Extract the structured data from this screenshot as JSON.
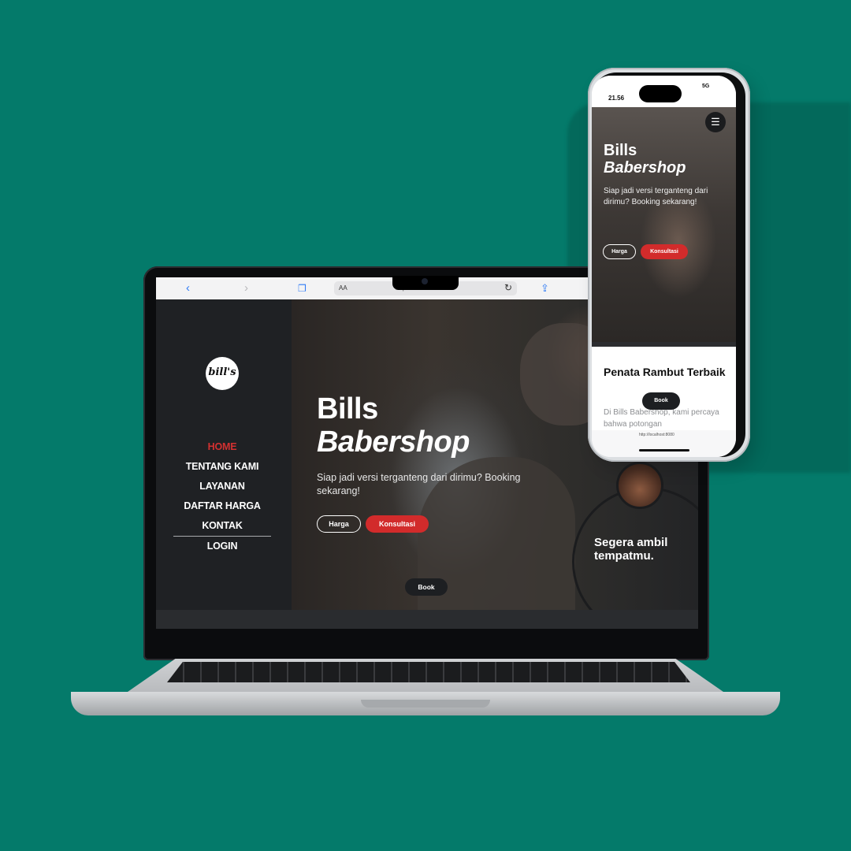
{
  "laptop": {
    "browser": {
      "url": "http://localhost:8080",
      "reader_label": "AA"
    },
    "sidebar": {
      "logo_text": "bill's",
      "nav": [
        "HOME",
        "TENTANG KAMI",
        "LAYANAN",
        "DAFTAR HARGA",
        "KONTAK"
      ],
      "login": "LOGIN",
      "active_item": "HOME"
    },
    "hero": {
      "title_line1": "Bills",
      "title_line2": "Babershop",
      "subtitle": "Siap jadi versi terganteng dari dirimu? Booking sekarang!",
      "btn_harga": "Harga",
      "btn_konsultasi": "Konsultasi",
      "btn_book": "Book",
      "circle_text": "Segera ambil tempatmu."
    }
  },
  "phone": {
    "status": {
      "time": "21.56",
      "signal": "5G"
    },
    "hero": {
      "title_line1": "Bills",
      "title_line2": "Babershop",
      "subtitle": "Siap jadi versi terganteng dari dirimu? Booking sekarang!",
      "btn_harga": "Harga",
      "btn_konsultasi": "Konsultasi"
    },
    "section": {
      "title": "Penata Rambut Terbaik",
      "text": "Di Bills Babershop, kami percaya bahwa potongan",
      "btn_book": "Book"
    },
    "url": "http://localhost:8080"
  },
  "colors": {
    "background": "#047a6a",
    "accent_red": "#d22b2b",
    "dark": "#1f2124"
  }
}
